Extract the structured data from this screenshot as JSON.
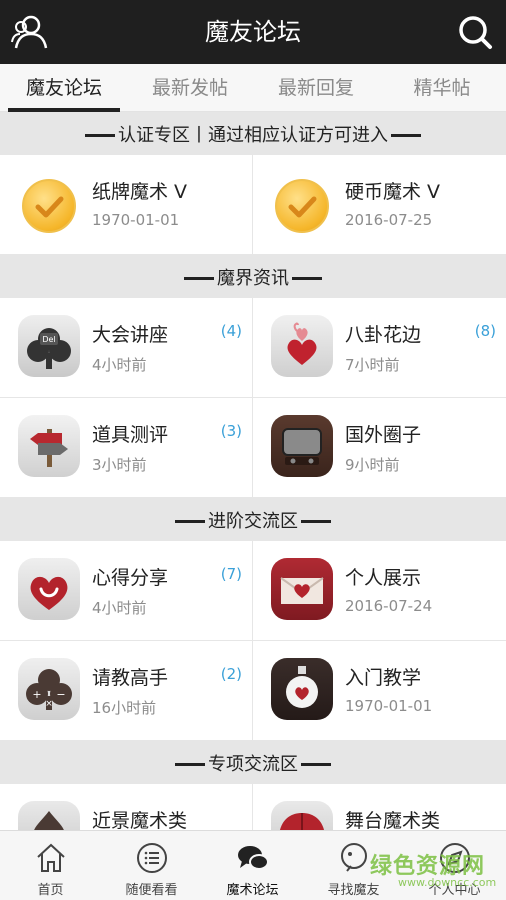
{
  "header": {
    "title": "魔友论坛",
    "user_icon": "user-icon",
    "search_icon": "search-icon"
  },
  "tabs": [
    {
      "label": "魔友论坛",
      "active": true
    },
    {
      "label": "最新发帖",
      "active": false
    },
    {
      "label": "最新回复",
      "active": false
    },
    {
      "label": "精华帖",
      "active": false
    }
  ],
  "sections": [
    {
      "title": "认证专区丨通过相应认证方可进入",
      "rows": [
        [
          {
            "name": "纸牌魔术 V",
            "sub": "1970-01-01",
            "count": "",
            "icon": "check-badge-icon"
          },
          {
            "name": "硬币魔术 V",
            "sub": "2016-07-25",
            "count": "",
            "icon": "check-badge-icon"
          }
        ]
      ]
    },
    {
      "title": "魔界资讯",
      "rows": [
        [
          {
            "name": "大会讲座",
            "sub": "4小时前",
            "count": "(4)",
            "icon": "club-card-icon"
          },
          {
            "name": "八卦花边",
            "sub": "7小时前",
            "count": "(8)",
            "icon": "hearts-icon"
          }
        ],
        [
          {
            "name": "道具测评",
            "sub": "3小时前",
            "count": "(3)",
            "icon": "signpost-icon"
          },
          {
            "name": "国外圈子",
            "sub": "9小时前",
            "count": "",
            "icon": "tv-icon"
          }
        ]
      ]
    },
    {
      "title": "进阶交流区",
      "rows": [
        [
          {
            "name": "心得分享",
            "sub": "4小时前",
            "count": "(7)",
            "icon": "heart-smile-icon"
          },
          {
            "name": "个人展示",
            "sub": "2016-07-24",
            "count": "",
            "icon": "heart-envelope-icon"
          }
        ],
        [
          {
            "name": "请教高手",
            "sub": "16小时前",
            "count": "(2)",
            "icon": "club-calculator-icon"
          },
          {
            "name": "入门教学",
            "sub": "1970-01-01",
            "count": "",
            "icon": "heart-bottle-icon"
          }
        ]
      ]
    },
    {
      "title": "专项交流区",
      "rows": [
        [
          {
            "name": "近景魔术类",
            "sub": "",
            "count": "",
            "icon": "spade-icon"
          },
          {
            "name": "舞台魔术类",
            "sub": "",
            "count": "",
            "icon": "red-umbrella-icon"
          }
        ]
      ]
    }
  ],
  "bottom_nav": [
    {
      "label": "首页",
      "icon": "home-icon"
    },
    {
      "label": "随便看看",
      "icon": "list-icon"
    },
    {
      "label": "魔术论坛",
      "icon": "chat-bubbles-icon",
      "active": true
    },
    {
      "label": "寻找魔友",
      "icon": "find-friend-icon"
    },
    {
      "label": "个人中心",
      "icon": "compass-icon"
    }
  ],
  "watermark": {
    "big": "绿色资源网",
    "small": "www.downcc.com"
  }
}
